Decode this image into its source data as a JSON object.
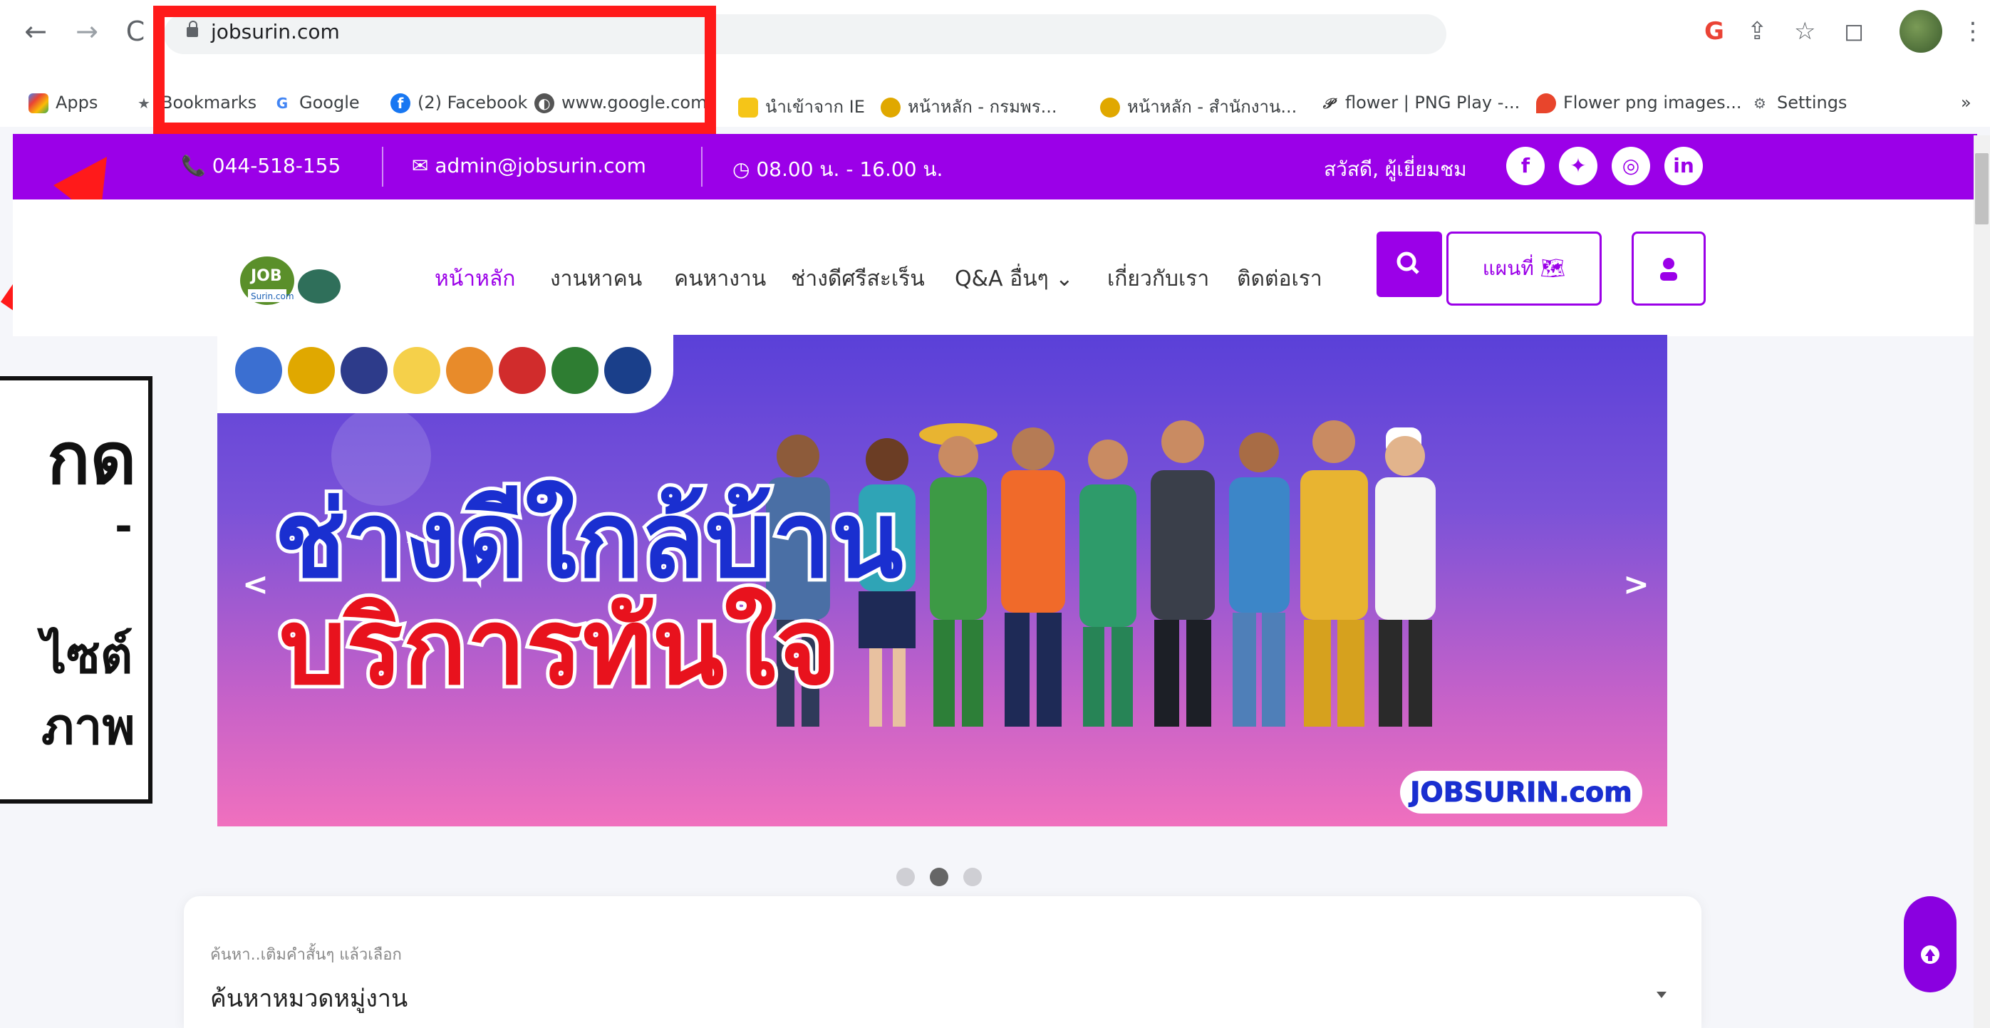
{
  "browser": {
    "url": "jobsurin.com",
    "bookmarks": [
      {
        "label": "Apps"
      },
      {
        "label": "Bookmarks"
      },
      {
        "label": "Google"
      },
      {
        "label": "(2) Facebook"
      },
      {
        "label": "www.google.com"
      },
      {
        "label": "นำเข้าจาก IE"
      },
      {
        "label": "หน้าหลัก - กรมพร..."
      },
      {
        "label": "หน้าหลัก - สำนักงาน..."
      },
      {
        "label": "flower | PNG Play -..."
      },
      {
        "label": "Flower png images..."
      },
      {
        "label": "Settings"
      }
    ],
    "more": "»"
  },
  "topbar": {
    "phone": "044-518-155",
    "email": "admin@jobsurin.com",
    "hours": "08.00 น. - 16.00 น.",
    "greeting": "สวัสดี, ผู้เยี่ยมชม",
    "socials": [
      "facebook",
      "twitter",
      "instagram",
      "linkedin"
    ]
  },
  "nav": {
    "items": [
      {
        "label": "หน้าหลัก",
        "active": true
      },
      {
        "label": "งานหาคน"
      },
      {
        "label": "คนหางาน"
      },
      {
        "label": "ช่างดีศรีสะเร็น"
      },
      {
        "label": "Q&A อื่นๆ"
      },
      {
        "label": "เกี่ยวกับเรา"
      },
      {
        "label": "ติดต่อเรา"
      }
    ],
    "map_label": "แผนที่"
  },
  "banner": {
    "headline_1": "ช่างดีใกล้บ้าน",
    "headline_2": "บริการทันใจ",
    "brand": "JOBSURIN.com",
    "prev": "<",
    "next": ">"
  },
  "search": {
    "hint": "ค้นหา..เติมคำสั้นๆ แล้วเลือก",
    "category": "ค้นหาหมวดหมู่งาน"
  },
  "overlay": {
    "lines": [
      "กด",
      "-",
      "ไซต์",
      "ภาพ"
    ]
  },
  "colors": {
    "brand_purple": "#9b00e8",
    "highlight_red": "#ff1a1a"
  }
}
